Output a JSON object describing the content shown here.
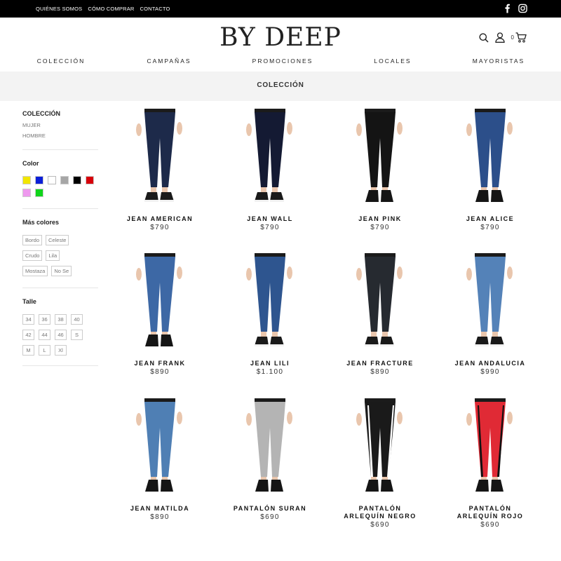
{
  "topbar": {
    "links": [
      "QUIÉNES SOMOS",
      "CÓMO COMPRAR",
      "CONTACTO"
    ]
  },
  "header": {
    "logo": "BY DEEP",
    "cart_count": "0",
    "nav": [
      "COLECCIÓN",
      "CAMPAÑAS",
      "PROMOCIONES",
      "LOCALES",
      "MAYORISTAS"
    ]
  },
  "page": {
    "title": "COLECCIÓN"
  },
  "sidebar": {
    "collection_title": "COLECCIÓN",
    "collection_links": [
      "MUJER",
      "HOMBRE"
    ],
    "color_title": "Color",
    "colors": [
      "#f2e600",
      "#0b1fd8",
      "#ffffff",
      "#a6a6a6",
      "#000000",
      "#d7000a",
      "#ee99ee",
      "#10d51a"
    ],
    "more_colors_title": "Más colores",
    "more_colors": [
      "Bordo",
      "Celeste",
      "Crudo",
      "Lila",
      "Mostaza",
      "No Se"
    ],
    "size_title": "Talle",
    "sizes": [
      "34",
      "36",
      "38",
      "40",
      "42",
      "44",
      "46",
      "S",
      "M",
      "L",
      "Xl"
    ]
  },
  "products": [
    {
      "name": "JEAN AMERICAN",
      "price": "$790",
      "pants_color": "#1d2a4a",
      "shoe": "sneaker"
    },
    {
      "name": "JEAN WALL",
      "price": "$790",
      "pants_color": "#141a33",
      "shoe": "sneaker"
    },
    {
      "name": "JEAN PINK",
      "price": "$790",
      "pants_color": "#141414",
      "shoe": "boot"
    },
    {
      "name": "JEAN ALICE",
      "price": "$790",
      "pants_color": "#2c4f8a",
      "shoe": "boot"
    },
    {
      "name": "JEAN FRANK",
      "price": "$890",
      "pants_color": "#3d68a5",
      "shoe": "boot"
    },
    {
      "name": "JEAN LILI",
      "price": "$1.100",
      "pants_color": "#2e558f",
      "shoe": "sneaker"
    },
    {
      "name": "JEAN FRACTURE",
      "price": "$890",
      "pants_color": "#262a30",
      "shoe": "sneaker"
    },
    {
      "name": "JEAN ANDALUCIA",
      "price": "$990",
      "pants_color": "#5482b8",
      "shoe": "sneaker"
    },
    {
      "name": "JEAN MATILDA",
      "price": "$890",
      "pants_color": "#4f7fb4",
      "shoe": "boot"
    },
    {
      "name": "PANTALÓN SURAN",
      "price": "$690",
      "pants_color": "#b4b4b4",
      "shoe": "boot"
    },
    {
      "name": "PANTALÓN ARLEQUÍN NEGRO",
      "price": "$690",
      "pants_color": "#1a1a1a",
      "shoe": "boot",
      "stripe": "#ffffff"
    },
    {
      "name": "PANTALÓN ARLEQUÍN ROJO",
      "price": "$690",
      "pants_color": "#e02a35",
      "shoe": "boot",
      "stripe": "#111111"
    }
  ]
}
